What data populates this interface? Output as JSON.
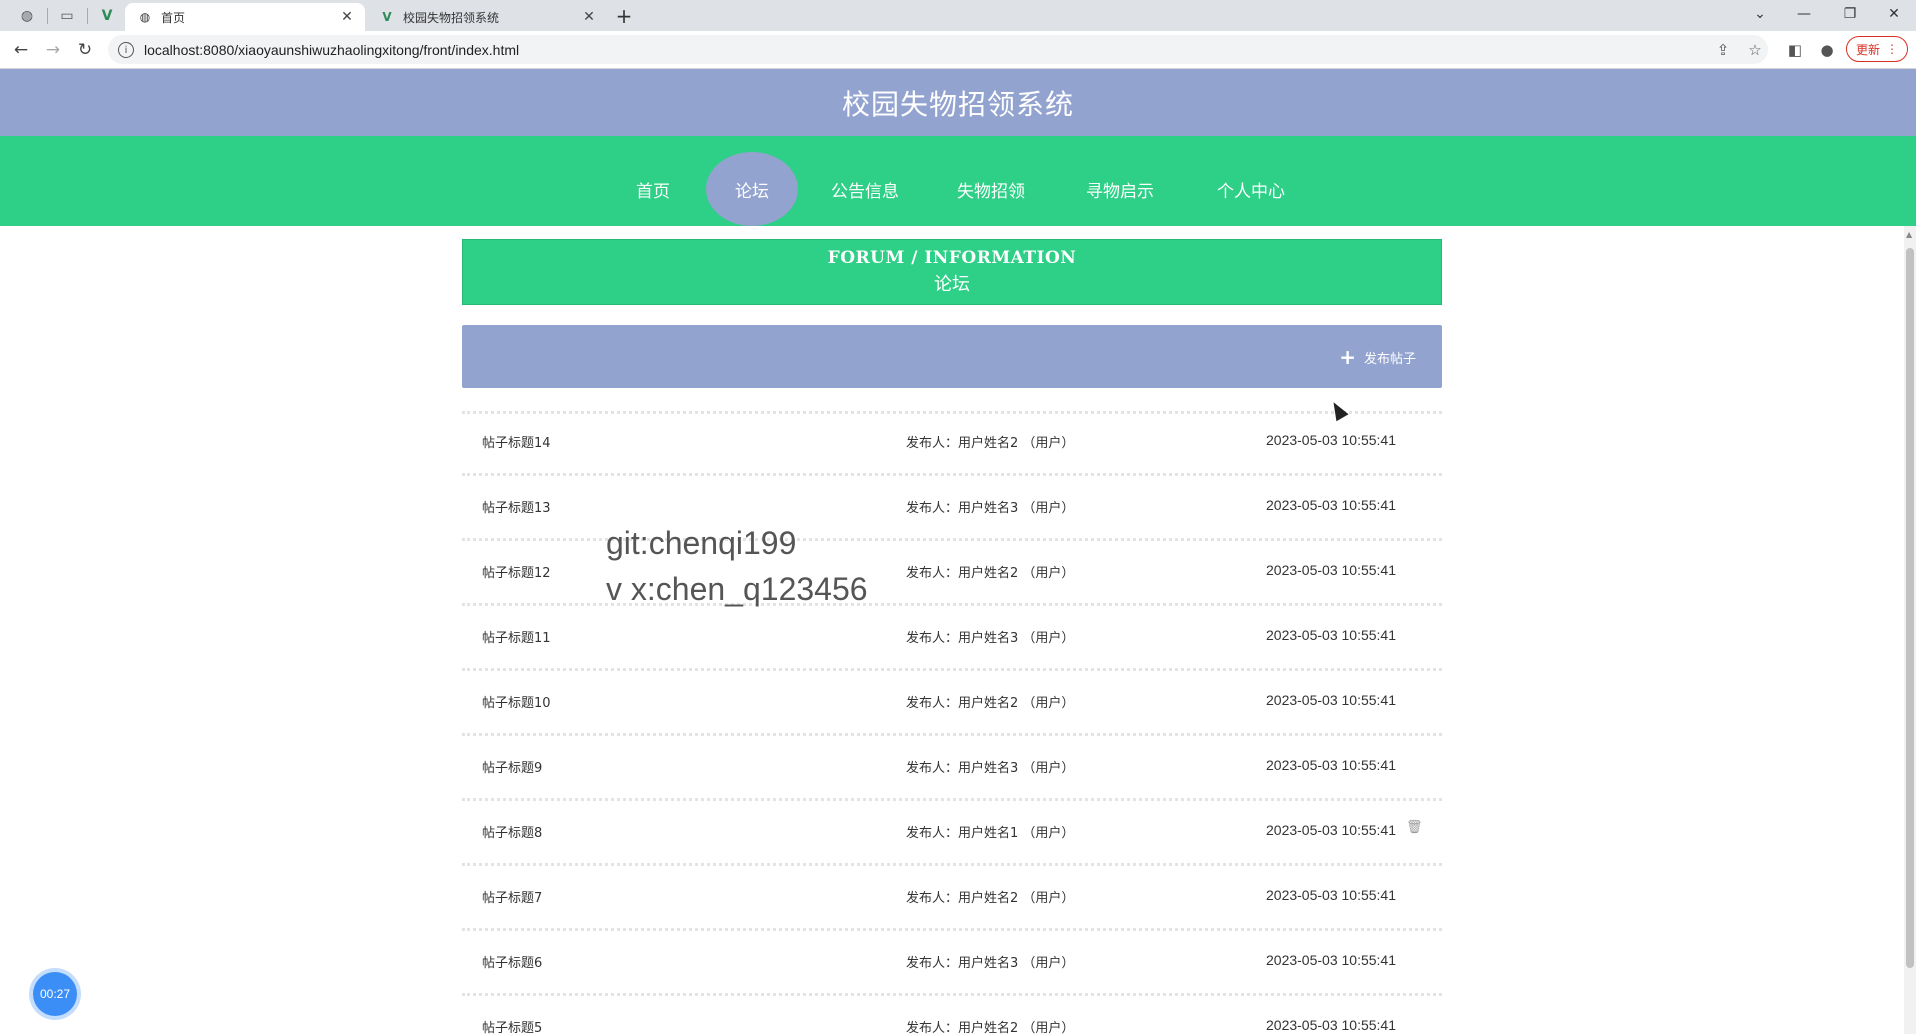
{
  "browser": {
    "tabs": [
      {
        "title": "首页",
        "active": true
      },
      {
        "title": "校园失物招领系统",
        "active": false
      }
    ],
    "url": "localhost:8080/xiaoyaunshiwuzhaolingxitong/front/index.html",
    "update_label": "更新"
  },
  "site": {
    "title": "校园失物招领系统",
    "nav": [
      "首页",
      "论坛",
      "公告信息",
      "失物招领",
      "寻物启示",
      "个人中心"
    ],
    "active_nav": "论坛"
  },
  "forum": {
    "banner_en": "FORUM / INFORMATION",
    "banner_cn": "论坛",
    "publish_label": "发布帖子",
    "posts": [
      {
        "title": "帖子标题14",
        "author": "发布人：用户姓名2 （用户）",
        "time": "2023-05-03 10:55:41"
      },
      {
        "title": "帖子标题13",
        "author": "发布人：用户姓名3 （用户）",
        "time": "2023-05-03 10:55:41"
      },
      {
        "title": "帖子标题12",
        "author": "发布人：用户姓名2 （用户）",
        "time": "2023-05-03 10:55:41"
      },
      {
        "title": "帖子标题11",
        "author": "发布人：用户姓名3 （用户）",
        "time": "2023-05-03 10:55:41"
      },
      {
        "title": "帖子标题10",
        "author": "发布人：用户姓名2 （用户）",
        "time": "2023-05-03 10:55:41"
      },
      {
        "title": "帖子标题9",
        "author": "发布人：用户姓名3 （用户）",
        "time": "2023-05-03 10:55:41"
      },
      {
        "title": "帖子标题8",
        "author": "发布人：用户姓名1 （用户）",
        "time": "2023-05-03 10:55:41"
      },
      {
        "title": "帖子标题7",
        "author": "发布人：用户姓名2 （用户）",
        "time": "2023-05-03 10:55:41"
      },
      {
        "title": "帖子标题6",
        "author": "发布人：用户姓名3 （用户）",
        "time": "2023-05-03 10:55:41"
      },
      {
        "title": "帖子标题5",
        "author": "发布人：用户姓名2 （用户）",
        "time": "2023-05-03 10:55:41"
      }
    ]
  },
  "watermark": {
    "line1": "git:chenqi199",
    "line2": "v x:chen_q123456"
  },
  "recorder": {
    "time": "00:27"
  },
  "colors": {
    "header": "#93a3cf",
    "nav": "#2ecf86",
    "accent": "#93a3cf"
  }
}
